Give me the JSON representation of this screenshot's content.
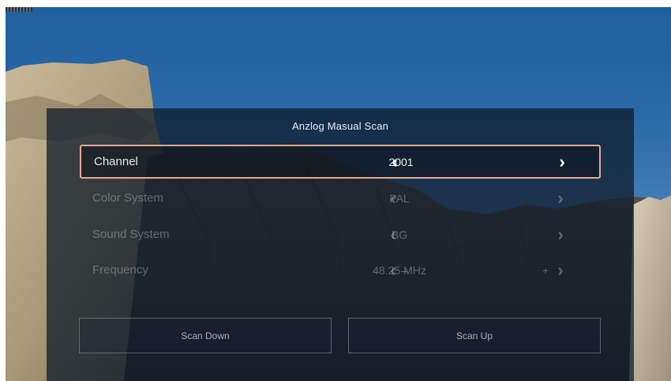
{
  "dialog": {
    "title": "Anzlog Masual Scan",
    "rows": [
      {
        "label": "Channel",
        "value": "2001",
        "selected": true
      },
      {
        "label": "Color System",
        "value": "PAL",
        "selected": false
      },
      {
        "label": "Sound System",
        "value": "BG",
        "selected": false
      },
      {
        "label": "Frequency",
        "value": "48.25 MHz",
        "selected": false
      }
    ],
    "buttons": {
      "scan_down": "Scan Down",
      "scan_up": "Scan Up"
    }
  },
  "icons": {
    "left_arrow": "‹",
    "right_arrow": "›",
    "minus": "–",
    "plus": "+"
  },
  "colors": {
    "sky": "#2b6aa8",
    "panel": "#0e1928",
    "focus_border": "#e3a98f"
  }
}
